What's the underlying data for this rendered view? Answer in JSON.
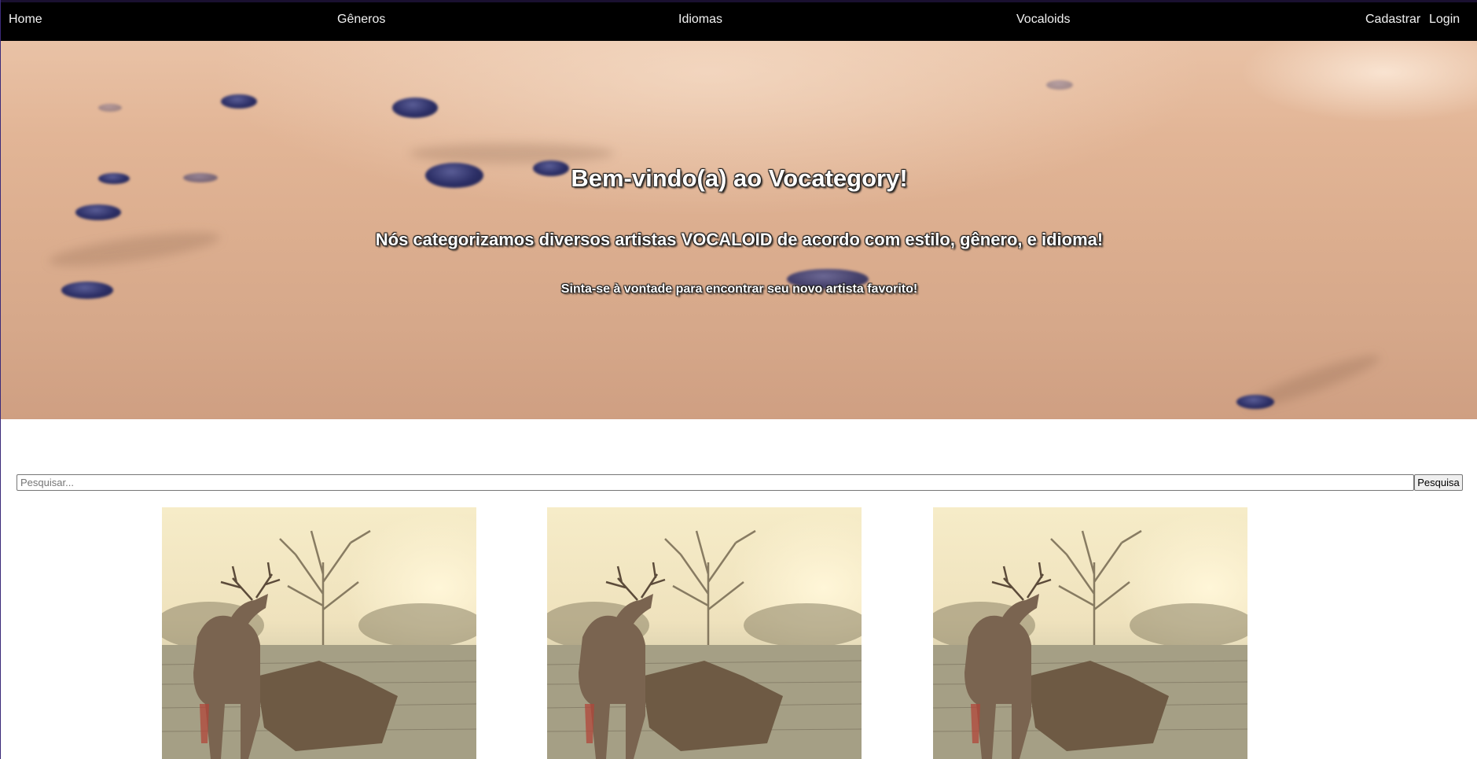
{
  "nav": {
    "home": "Home",
    "generos": "Gêneros",
    "idiomas": "Idiomas",
    "vocaloids": "Vocaloids",
    "cadastrar": "Cadastrar",
    "login": "Login"
  },
  "hero": {
    "title": "Bem-vindo(a) ao Vocategory!",
    "subtitle": "Nós categorizamos diversos artistas VOCALOID de acordo com estilo, gênero, e idioma!",
    "tagline": "Sinta-se à vontade para encontrar seu novo artista favorito!"
  },
  "search": {
    "placeholder": "Pesquisar...",
    "value": "",
    "button_label": "Pesquisa"
  },
  "cards": [
    {
      "image": "deer-in-field-image"
    },
    {
      "image": "deer-in-field-image"
    },
    {
      "image": "deer-in-field-image"
    }
  ],
  "colors": {
    "navbar_bg": "#000000",
    "nav_text": "#f2f2f2",
    "hero_sand": "#dcae8f",
    "pebble": "#2c2f66"
  }
}
